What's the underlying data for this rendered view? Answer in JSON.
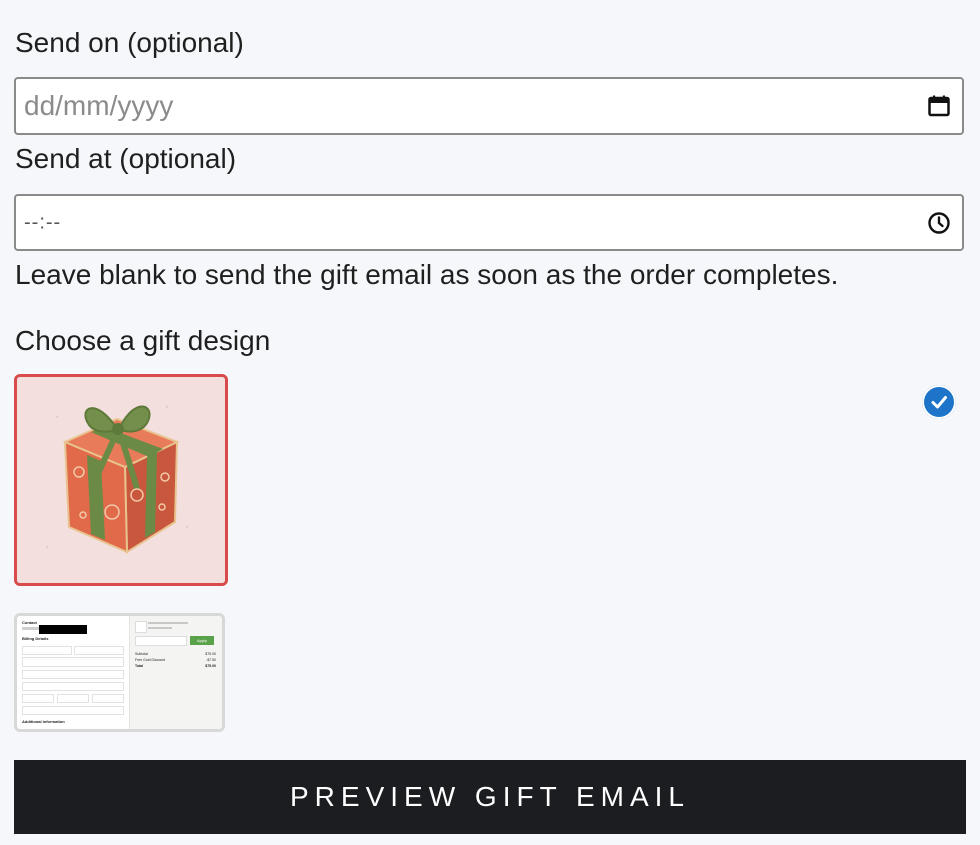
{
  "send_on": {
    "label": "Send on (optional)",
    "placeholder": "dd/mm/yyyy",
    "icon": "calendar-icon"
  },
  "send_at": {
    "label": "Send at (optional)",
    "value": "--:--",
    "icon": "clock-icon"
  },
  "help_text": "Leave blank to send the gift email as soon as the order completes.",
  "design": {
    "label": "Choose a gift design",
    "options": [
      {
        "name": "gift-box-design",
        "selected": true
      },
      {
        "name": "checkout-screenshot-design",
        "selected": false
      }
    ],
    "selected_badge_icon": "check-icon",
    "selected_badge_color": "#1e74c8",
    "selected_border_color": "#d94b4b"
  },
  "preview_button": {
    "label": "PREVIEW GIFT EMAIL",
    "background": "#1c1d21"
  },
  "checkout_thumbnail": {
    "contact": "Contact",
    "billing": "Billing Details",
    "additional": "Additional Information",
    "apply": "Apply",
    "subtotal": "Subtotal",
    "shipping": "Free Gold Discount",
    "total": "Total",
    "price": "$75.00",
    "discount": "-$7.50",
    "total_value": "$75.00"
  }
}
